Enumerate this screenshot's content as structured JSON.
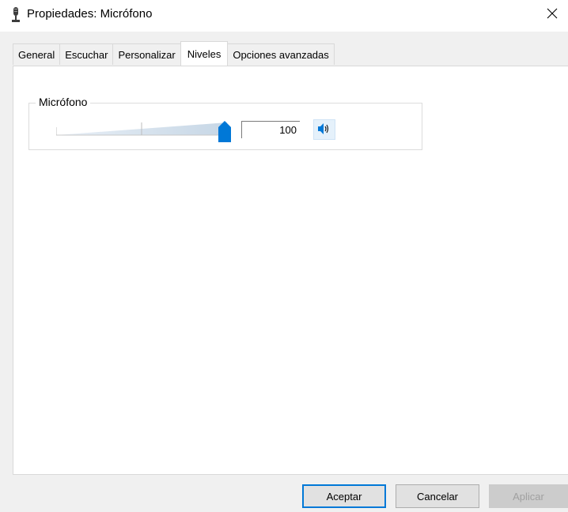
{
  "window": {
    "title": "Propiedades: Micrófono"
  },
  "tabs": [
    {
      "label": "General",
      "active": false
    },
    {
      "label": "Escuchar",
      "active": false
    },
    {
      "label": "Personalizar",
      "active": false
    },
    {
      "label": "Niveles",
      "active": true
    },
    {
      "label": "Opciones avanzadas",
      "active": false
    }
  ],
  "levels": {
    "group_label": "Micrófono",
    "slider_value": 100,
    "value_text": "100",
    "accent_color": "#0078d7"
  },
  "footer": {
    "accept_label": "Aceptar",
    "cancel_label": "Cancelar",
    "apply_label": "Aplicar"
  }
}
